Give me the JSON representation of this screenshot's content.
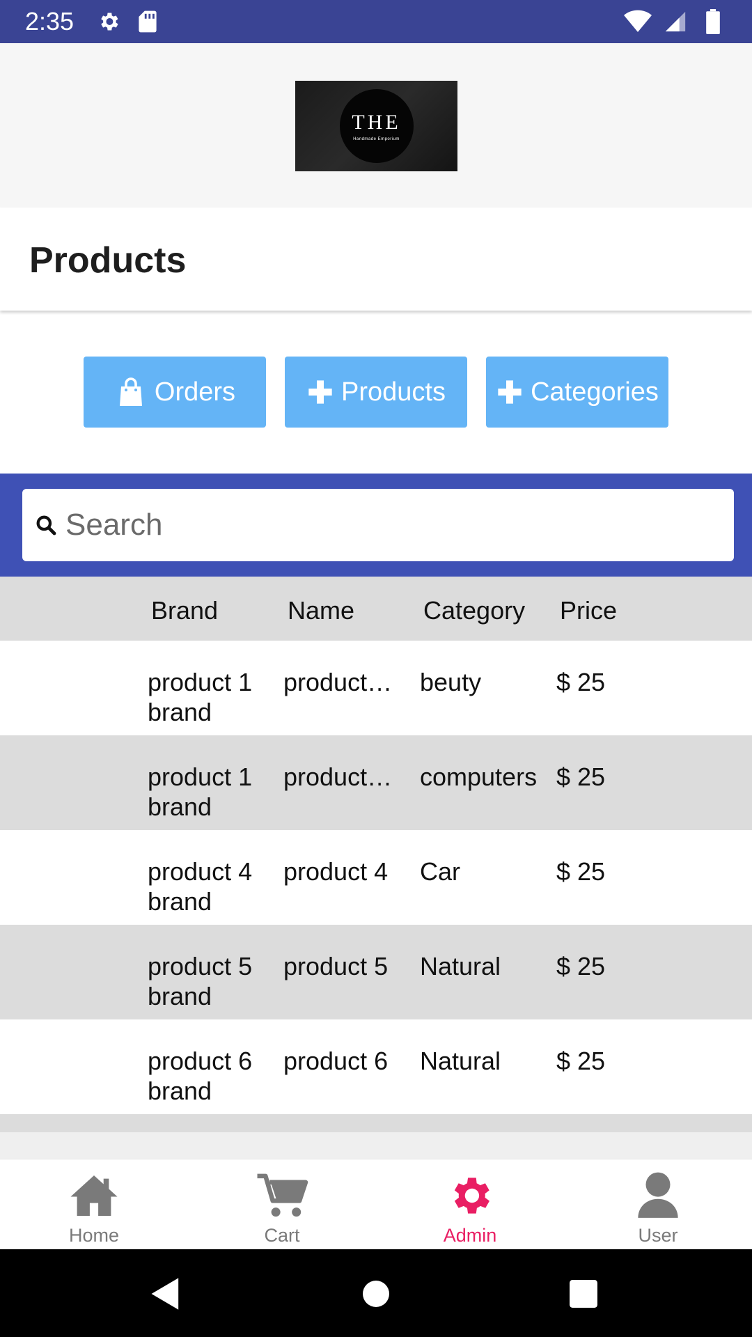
{
  "status_bar": {
    "time": "2:35",
    "icons_left": [
      "gear-icon",
      "sd-card-icon"
    ],
    "icons_right": [
      "wifi-icon",
      "signal-icon",
      "battery-icon"
    ]
  },
  "header": {
    "logo_text": "THE",
    "logo_subtext": "Handmade Emporium"
  },
  "page": {
    "title": "Products"
  },
  "actions": {
    "orders_label": "Orders",
    "products_label": "Products",
    "categories_label": "Categories"
  },
  "search": {
    "placeholder": "Search",
    "value": ""
  },
  "table": {
    "headers": [
      "Brand",
      "Name",
      "Category",
      "Price"
    ],
    "rows": [
      {
        "brand": "product 1 brand",
        "name": "product…",
        "category": "beuty",
        "price": "$ 25"
      },
      {
        "brand": "product 1 brand",
        "name": "product…",
        "category": "computers",
        "price": "$ 25"
      },
      {
        "brand": "product 4 brand",
        "name": "product 4",
        "category": "Car",
        "price": "$ 25"
      },
      {
        "brand": "product 5 brand",
        "name": "product 5",
        "category": "Natural",
        "price": "$ 25"
      },
      {
        "brand": "product 6 brand",
        "name": "product 6",
        "category": "Natural",
        "price": "$ 25"
      }
    ]
  },
  "bottom_nav": {
    "items": [
      {
        "label": "Home",
        "icon": "home-icon"
      },
      {
        "label": "Cart",
        "icon": "cart-icon"
      },
      {
        "label": "Admin",
        "icon": "gear-icon",
        "active": true
      },
      {
        "label": "User",
        "icon": "user-icon"
      }
    ]
  },
  "colors": {
    "status_bar": "#3a4494",
    "button": "#64b4f6",
    "search_band": "#3f51b5",
    "active_nav": "#e91e63",
    "inactive_nav": "#7a7a7a",
    "row_alt": "#dcdcdc"
  }
}
